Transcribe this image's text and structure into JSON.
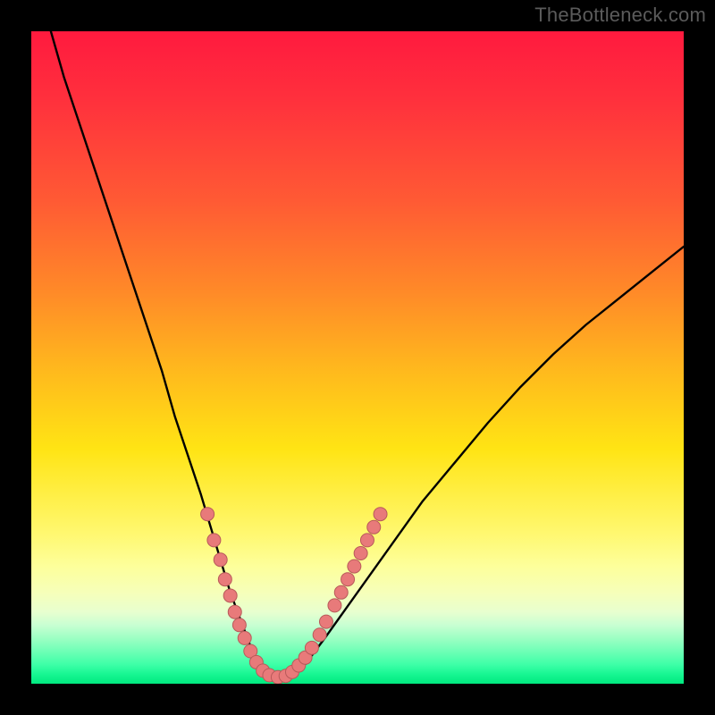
{
  "watermark": "TheBottleneck.com",
  "colors": {
    "frame": "#000000",
    "watermark_text": "#5b5b5b",
    "curve_stroke": "#000000",
    "marker_fill": "#e87a7a",
    "marker_stroke": "#b85a5a",
    "grad_top": "#ff1a3e",
    "grad_mid": "#ffe414",
    "grad_bottom": "#00e97f"
  },
  "chart_data": {
    "type": "line",
    "title": "",
    "xlabel": "",
    "ylabel": "",
    "xlim": [
      0,
      100
    ],
    "ylim": [
      0,
      100
    ],
    "grid": false,
    "legend": false,
    "series": [
      {
        "name": "bottleneck-curve",
        "x": [
          3,
          5,
          8,
          11,
          14,
          17,
          20,
          22,
          24,
          26,
          27.5,
          29,
          30.5,
          32,
          33.5,
          35,
          36.5,
          38,
          40,
          42,
          45,
          50,
          55,
          60,
          65,
          70,
          75,
          80,
          85,
          90,
          95,
          100
        ],
        "y": [
          100,
          93,
          84,
          75,
          66,
          57,
          48,
          41,
          35,
          29,
          24,
          19,
          14,
          10,
          6,
          3,
          1.5,
          1,
          1.5,
          3,
          7,
          14,
          21,
          28,
          34,
          40,
          45.5,
          50.5,
          55,
          59,
          63,
          67
        ]
      }
    ],
    "markers": {
      "name": "highlight-dots",
      "points": [
        {
          "x": 27.0,
          "y": 26
        },
        {
          "x": 28.0,
          "y": 22
        },
        {
          "x": 29.0,
          "y": 19
        },
        {
          "x": 29.7,
          "y": 16
        },
        {
          "x": 30.5,
          "y": 13.5
        },
        {
          "x": 31.2,
          "y": 11
        },
        {
          "x": 31.9,
          "y": 9
        },
        {
          "x": 32.7,
          "y": 7
        },
        {
          "x": 33.6,
          "y": 5
        },
        {
          "x": 34.5,
          "y": 3.3
        },
        {
          "x": 35.5,
          "y": 2
        },
        {
          "x": 36.5,
          "y": 1.3
        },
        {
          "x": 37.8,
          "y": 1
        },
        {
          "x": 39.0,
          "y": 1.2
        },
        {
          "x": 40.0,
          "y": 1.8
        },
        {
          "x": 41.0,
          "y": 2.8
        },
        {
          "x": 42.0,
          "y": 4
        },
        {
          "x": 43.0,
          "y": 5.5
        },
        {
          "x": 44.2,
          "y": 7.5
        },
        {
          "x": 45.2,
          "y": 9.5
        },
        {
          "x": 46.5,
          "y": 12
        },
        {
          "x": 47.5,
          "y": 14
        },
        {
          "x": 48.5,
          "y": 16
        },
        {
          "x": 49.5,
          "y": 18
        },
        {
          "x": 50.5,
          "y": 20
        },
        {
          "x": 51.5,
          "y": 22
        },
        {
          "x": 52.5,
          "y": 24
        },
        {
          "x": 53.5,
          "y": 26
        }
      ]
    }
  }
}
